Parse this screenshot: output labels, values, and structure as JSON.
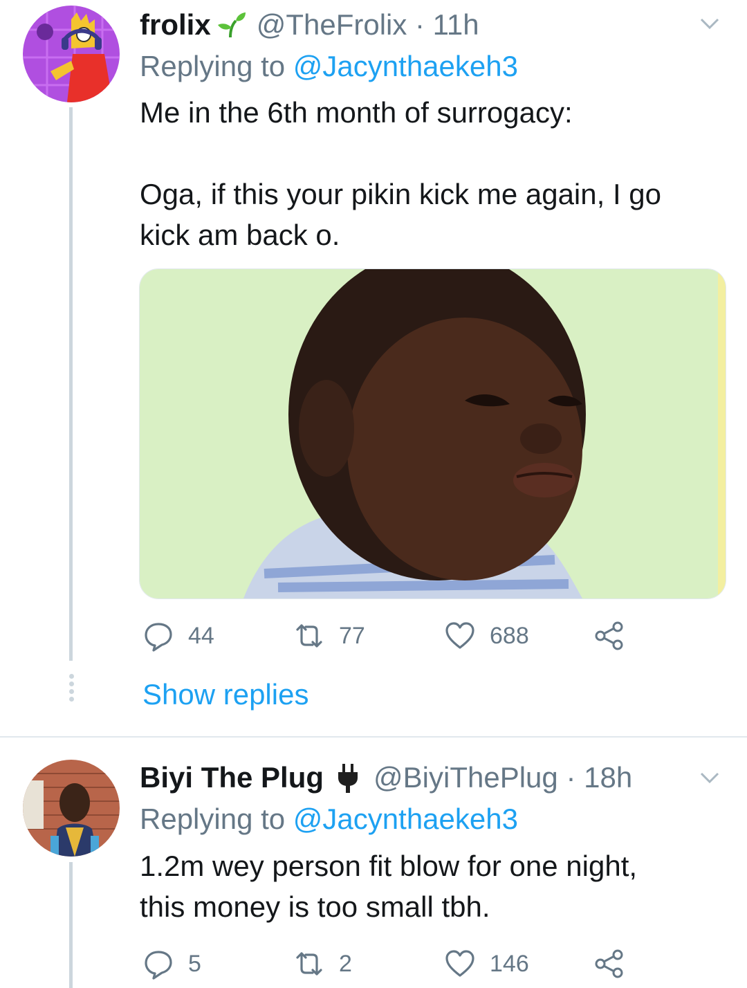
{
  "tweets": [
    {
      "name": "frolix",
      "emoji_icon": "seedling-icon",
      "handle_time": "@TheFrolix · 11h",
      "replying_label": "Replying to",
      "replying_to": "@Jacynthaekeh3",
      "text_line1": "Me in the 6th month of surrogacy:",
      "text_line2": "Oga, if this your pikin kick me again, I go",
      "text_line3": "kick am back o.",
      "replies": "44",
      "retweets": "77",
      "likes": "688",
      "show_replies": "Show replies"
    },
    {
      "name": "Biyi The Plug",
      "emoji_icon": "plug-icon",
      "handle_time": "@BiyiThePlug · 18h",
      "replying_label": "Replying to",
      "replying_to": "@Jacynthaekeh3",
      "text_line1": "1.2m wey person fit blow for one night,",
      "text_line2": "this money is too small tbh.",
      "replies": "5",
      "retweets": "2",
      "likes": "146"
    }
  ],
  "colors": {
    "accent": "#1da1f2",
    "muted": "#657786",
    "thread": "#ccd6dd",
    "media_bg": "#d9f0c4"
  }
}
